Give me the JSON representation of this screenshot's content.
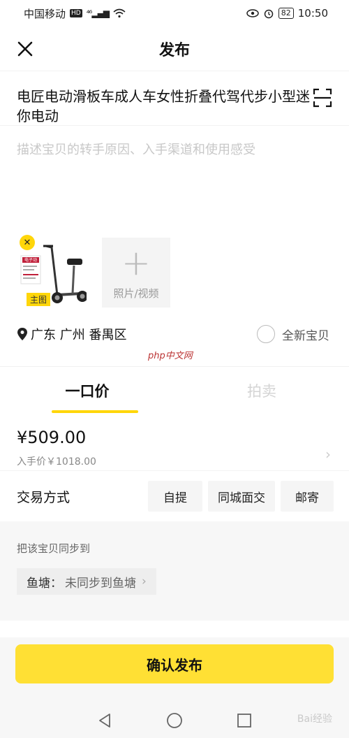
{
  "status_bar": {
    "carrier": "中国移动",
    "hd_badge": "HD",
    "signal": "46",
    "battery": "82",
    "time": "10:50"
  },
  "header": {
    "title": "发布"
  },
  "listing": {
    "title": "电匠电动滑板车成人车女性折叠代驾代步小型迷你电动",
    "description_placeholder": "描述宝贝的转手原因、入手渠道和使用感受"
  },
  "photos": {
    "delete_glyph": "✕",
    "main_tag": "主图",
    "add_label": "照片/视频",
    "thumb_sticker": "电子动"
  },
  "location": {
    "text": "广东 广州 番禺区"
  },
  "new_item_label": "全新宝贝",
  "watermark": "php中文网",
  "tabs": [
    {
      "label": "一口价",
      "active": true
    },
    {
      "label": "拍卖",
      "active": false
    }
  ],
  "price": {
    "current": "¥509.00",
    "original": "入手价￥1018.00"
  },
  "trade": {
    "label": "交易方式",
    "options": [
      "自提",
      "同城面交",
      "邮寄"
    ]
  },
  "sync": {
    "title": "把该宝贝同步到",
    "chip_label": "鱼塘：",
    "chip_value": "未同步到鱼塘"
  },
  "confirm_label": "确认发布",
  "nav_watermark": "Bai经验",
  "colors": {
    "accent_yellow": "#ffe034",
    "tag_yellow": "#ffd60a",
    "placeholder_gray": "#c8c8c8",
    "section_bg": "#f7f7f7"
  },
  "icons": [
    "close-icon",
    "scan-icon",
    "location-pin-icon",
    "plus-icon",
    "chevron-right-icon",
    "back-nav-icon",
    "home-nav-icon",
    "recents-nav-icon"
  ]
}
